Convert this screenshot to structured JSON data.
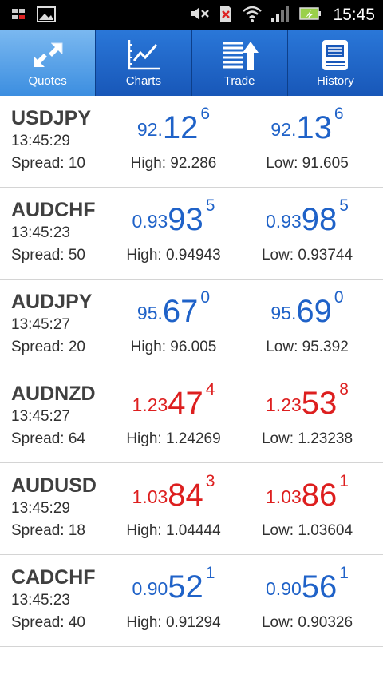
{
  "status_bar": {
    "time": "15:45",
    "icons": [
      "notification-icon",
      "image-icon",
      "mute-icon",
      "no-sim-icon",
      "wifi-icon",
      "signal-icon",
      "battery-charging-icon"
    ]
  },
  "tabs": [
    {
      "label": "Quotes",
      "icon": "quotes-arrows-icon",
      "active": true
    },
    {
      "label": "Charts",
      "icon": "line-chart-icon",
      "active": false
    },
    {
      "label": "Trade",
      "icon": "trade-list-arrow-icon",
      "active": false
    },
    {
      "label": "History",
      "icon": "history-book-icon",
      "active": false
    }
  ],
  "colors": {
    "up": "#1f62c8",
    "down": "#dd1f1f",
    "tab_bar": "#1e64c8"
  },
  "quotes": [
    {
      "symbol": "USDJPY",
      "time": "13:45:29",
      "spread": "Spread: 10",
      "bid": {
        "small": "92.",
        "big": "12",
        "sup": "6"
      },
      "ask": {
        "small": "92.",
        "big": "13",
        "sup": "6"
      },
      "high": "High: 92.286",
      "low": "Low: 91.605",
      "direction": "up"
    },
    {
      "symbol": "AUDCHF",
      "time": "13:45:23",
      "spread": "Spread: 50",
      "bid": {
        "small": "0.93",
        "big": "93",
        "sup": "5"
      },
      "ask": {
        "small": "0.93",
        "big": "98",
        "sup": "5"
      },
      "high": "High: 0.94943",
      "low": "Low: 0.93744",
      "direction": "up"
    },
    {
      "symbol": "AUDJPY",
      "time": "13:45:27",
      "spread": "Spread: 20",
      "bid": {
        "small": "95.",
        "big": "67",
        "sup": "0"
      },
      "ask": {
        "small": "95.",
        "big": "69",
        "sup": "0"
      },
      "high": "High: 96.005",
      "low": "Low: 95.392",
      "direction": "up"
    },
    {
      "symbol": "AUDNZD",
      "time": "13:45:27",
      "spread": "Spread: 64",
      "bid": {
        "small": "1.23",
        "big": "47",
        "sup": "4"
      },
      "ask": {
        "small": "1.23",
        "big": "53",
        "sup": "8"
      },
      "high": "High: 1.24269",
      "low": "Low: 1.23238",
      "direction": "down"
    },
    {
      "symbol": "AUDUSD",
      "time": "13:45:29",
      "spread": "Spread: 18",
      "bid": {
        "small": "1.03",
        "big": "84",
        "sup": "3"
      },
      "ask": {
        "small": "1.03",
        "big": "86",
        "sup": "1"
      },
      "high": "High: 1.04444",
      "low": "Low: 1.03604",
      "direction": "down"
    },
    {
      "symbol": "CADCHF",
      "time": "13:45:23",
      "spread": "Spread: 40",
      "bid": {
        "small": "0.90",
        "big": "52",
        "sup": "1"
      },
      "ask": {
        "small": "0.90",
        "big": "56",
        "sup": "1"
      },
      "high": "High: 0.91294",
      "low": "Low: 0.90326",
      "direction": "up"
    }
  ]
}
